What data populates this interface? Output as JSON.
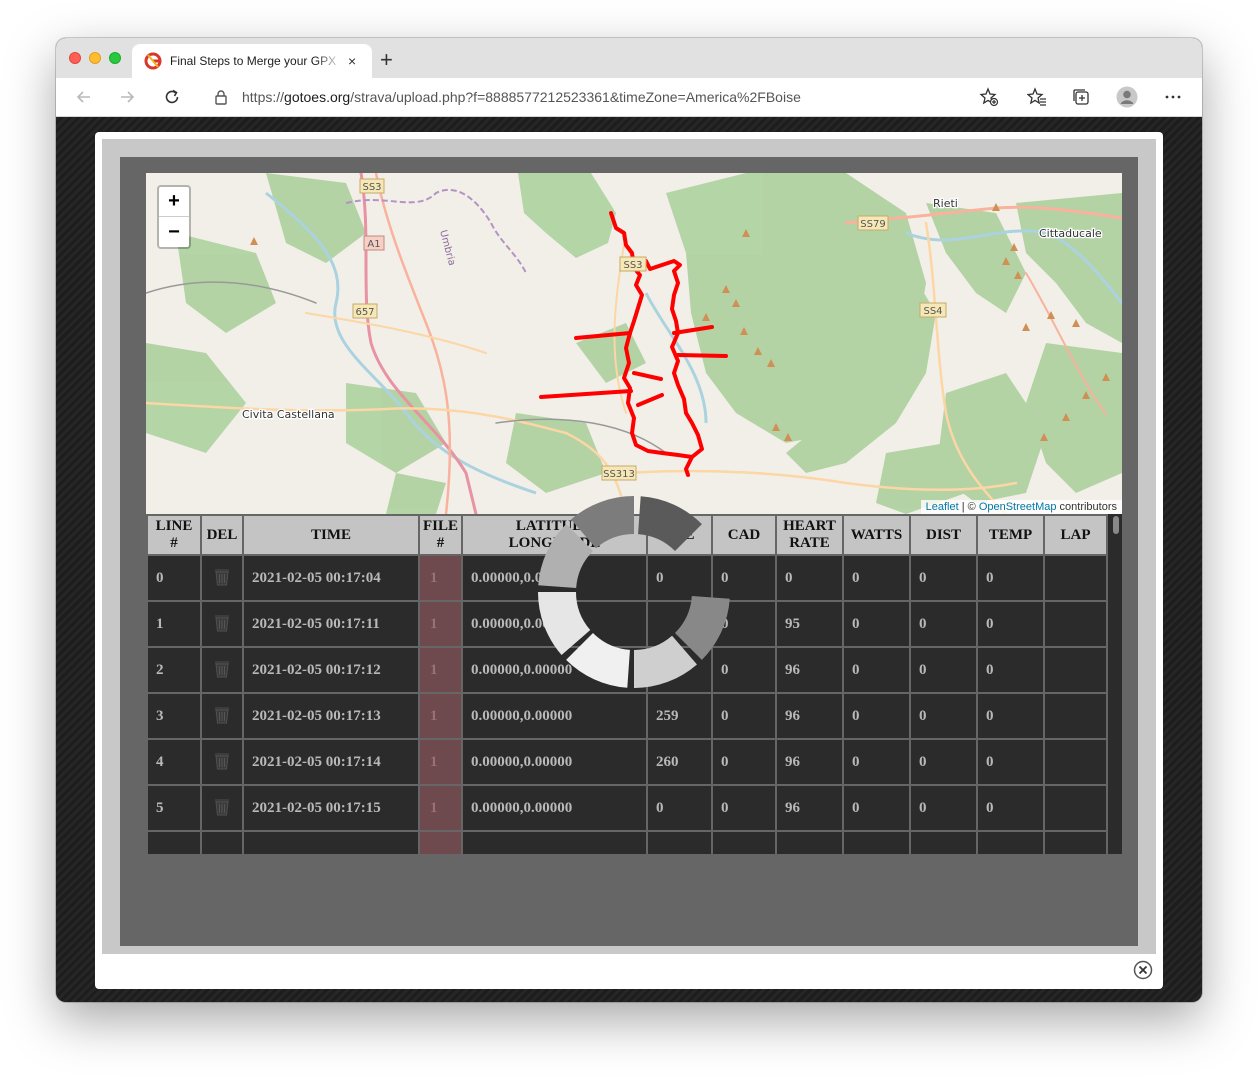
{
  "browser": {
    "tab_title": "Final Steps to Merge your GPX",
    "new_tab_label": "+",
    "tab_close": "×",
    "url_scheme": "https://",
    "url_host": "gotoes.org",
    "url_path": "/strava/upload.php?f=8888577212523361&timeZone=America%2FBoise"
  },
  "map": {
    "zoom_in": "+",
    "zoom_out": "−",
    "attribution_leaflet": "Leaflet",
    "attribution_sep": " | © ",
    "attribution_osm": "OpenStreetMap",
    "attribution_suffix": " contributors",
    "labels": {
      "ss3": "SS3",
      "a1": "A1",
      "umbria": "Umbria",
      "r657": "657",
      "civita": "Civita Castellana",
      "ss3b": "SS3",
      "ss313": "SS313",
      "ss79": "SS79",
      "rieti": "Rieti",
      "cittaducale": "Cittaducale",
      "ss4": "SS4"
    }
  },
  "table": {
    "headers": {
      "line_a": "LINE",
      "line_b": "#",
      "del": "DEL",
      "time": "TIME",
      "file_a": "FILE",
      "file_b": "#",
      "latlon_a": "LATITUDE",
      "latlon_b": "LONGITUDE",
      "ele": "ELE",
      "cad": "CAD",
      "hr_a": "HEART",
      "hr_b": "RATE",
      "watts": "WATTS",
      "dist": "DIST",
      "temp": "TEMP",
      "lap": "LAP"
    },
    "rows": [
      {
        "line": "0",
        "time": "2021-02-05 00:17:04",
        "file": "1",
        "latlon": "0.00000,0.00000",
        "ele": "0",
        "cad": "0",
        "hr": "0",
        "watts": "0",
        "dist": "0",
        "temp": "0",
        "lap": ""
      },
      {
        "line": "1",
        "time": "2021-02-05 00:17:11",
        "file": "1",
        "latlon": "0.00000,0.00000",
        "ele": "",
        "cad": "0",
        "hr": "95",
        "watts": "0",
        "dist": "0",
        "temp": "0",
        "lap": ""
      },
      {
        "line": "2",
        "time": "2021-02-05 00:17:12",
        "file": "1",
        "latlon": "0.00000,0.00000",
        "ele": "259",
        "cad": "0",
        "hr": "96",
        "watts": "0",
        "dist": "0",
        "temp": "0",
        "lap": ""
      },
      {
        "line": "3",
        "time": "2021-02-05 00:17:13",
        "file": "1",
        "latlon": "0.00000,0.00000",
        "ele": "259",
        "cad": "0",
        "hr": "96",
        "watts": "0",
        "dist": "0",
        "temp": "0",
        "lap": ""
      },
      {
        "line": "4",
        "time": "2021-02-05 00:17:14",
        "file": "1",
        "latlon": "0.00000,0.00000",
        "ele": "260",
        "cad": "0",
        "hr": "96",
        "watts": "0",
        "dist": "0",
        "temp": "0",
        "lap": ""
      },
      {
        "line": "5",
        "time": "2021-02-05 00:17:15",
        "file": "1",
        "latlon": "0.00000,0.00000",
        "ele": "0",
        "cad": "0",
        "hr": "96",
        "watts": "0",
        "dist": "0",
        "temp": "0",
        "lap": ""
      },
      {
        "line": "",
        "time": "",
        "file": "",
        "latlon": "",
        "ele": "",
        "cad": "",
        "hr": "",
        "watts": "",
        "dist": "",
        "temp": "",
        "lap": ""
      }
    ]
  },
  "colors": {
    "route": "#ff0000",
    "accent_link": "#0078a8",
    "file_cell": "#6e4a4f"
  },
  "icons": [
    "reload-icon",
    "lock-icon",
    "favorite-add-icon",
    "favorites-icon",
    "collections-icon",
    "profile-icon",
    "more-icon",
    "trash-icon",
    "loading-spinner",
    "close-icon"
  ]
}
